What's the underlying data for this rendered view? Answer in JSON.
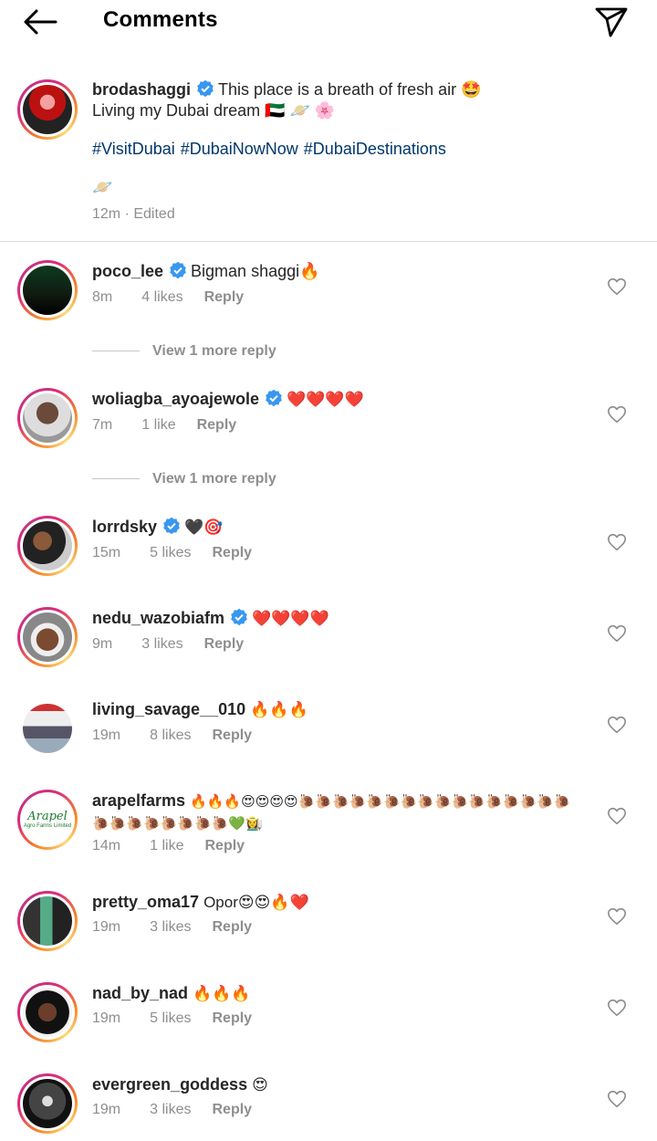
{
  "header": {
    "title": "Comments",
    "back_icon": "arrow-left-icon",
    "share_icon": "paper-plane-icon"
  },
  "post": {
    "username": "brodashaggi",
    "verified": true,
    "line1": "This place is a breath of fresh air 🤩",
    "line2": "Living my Dubai dream 🇦🇪 🪐 🌸",
    "hashtags": [
      "#VisitDubai",
      "#DubaiNowNow",
      "#DubaiDestinations"
    ],
    "extra_emoji": "🪐",
    "time": "12m",
    "edited": "Edited"
  },
  "comments": [
    {
      "username": "poco_lee",
      "verified": true,
      "text": "Bigman shaggi🔥",
      "time": "8m",
      "likes": "4 likes",
      "reply": "Reply",
      "view_more": "View 1 more reply"
    },
    {
      "username": "woliagba_ayoajewole",
      "verified": true,
      "text": "❤️❤️❤️❤️",
      "time": "7m",
      "likes": "1 like",
      "reply": "Reply",
      "view_more": "View 1 more reply"
    },
    {
      "username": "lorrdsky",
      "verified": true,
      "text": "🖤🎯",
      "time": "15m",
      "likes": "5 likes",
      "reply": "Reply"
    },
    {
      "username": "nedu_wazobiafm",
      "verified": true,
      "text": "❤️❤️❤️❤️",
      "time": "9m",
      "likes": "3 likes",
      "reply": "Reply"
    },
    {
      "username": "living_savage__010",
      "verified": false,
      "text": "🔥🔥🔥",
      "time": "19m",
      "likes": "8 likes",
      "reply": "Reply"
    },
    {
      "username": "arapelfarms",
      "verified": false,
      "text": "🔥🔥🔥😍😍😍😍🐌🐌🐌🐌🐌🐌🐌🐌🐌🐌🐌🐌🐌🐌🐌🐌🐌🐌🐌🐌🐌🐌🐌🐌💚👩‍🌾",
      "time": "14m",
      "likes": "1 like",
      "reply": "Reply"
    },
    {
      "username": "pretty_oma17",
      "verified": false,
      "text": "Opor😍😍🔥❤️",
      "time": "19m",
      "likes": "3 likes",
      "reply": "Reply"
    },
    {
      "username": "nad_by_nad",
      "verified": false,
      "text": "🔥🔥🔥",
      "time": "19m",
      "likes": "5 likes",
      "reply": "Reply"
    },
    {
      "username": "evergreen_goddess",
      "verified": false,
      "text": "😍",
      "time": "19m",
      "likes": "3 likes",
      "reply": "Reply"
    }
  ],
  "logo_text": {
    "brand": "Arapel",
    "sub": "Agro Farms Limited"
  },
  "colors": {
    "verified_blue": "#3897f0",
    "link_blue": "#00376b",
    "meta_gray": "#8e8e8e",
    "ring_start": "#f58529",
    "ring_end": "#c13584"
  }
}
